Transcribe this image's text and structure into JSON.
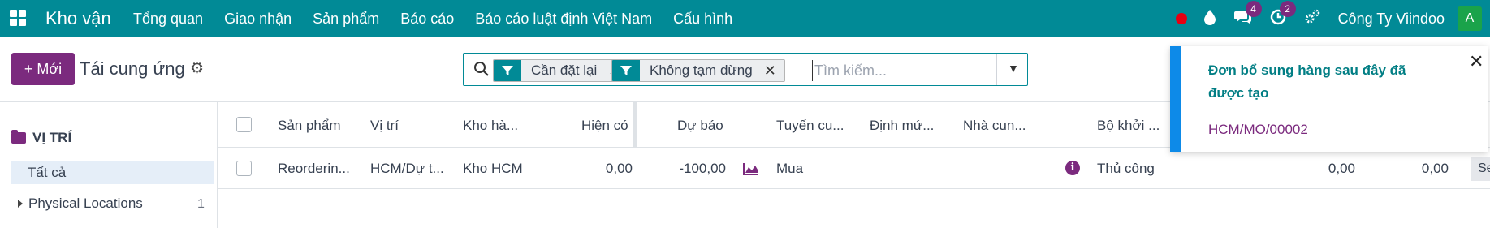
{
  "navbar": {
    "brand": "Kho vận",
    "menu": [
      "Tổng quan",
      "Giao nhận",
      "Sản phẩm",
      "Báo cáo",
      "Báo cáo luật định Việt Nam",
      "Cấu hình"
    ],
    "messages_badge": "4",
    "activities_badge": "2",
    "company": "Công Ty Viindoo",
    "avatar_letter": "A"
  },
  "control": {
    "new_button": "+ Mới",
    "title": "Tái cung ứng",
    "facets": [
      "Cần đặt lại",
      "Không tạm dừng"
    ],
    "facet_remove": "✕",
    "search_placeholder": "Tìm kiếm..."
  },
  "sidebar": {
    "title": "VỊ TRÍ",
    "all_label": "Tất cả",
    "location_label": "Physical Locations",
    "location_count": "1"
  },
  "table": {
    "headers": [
      "Sản phẩm",
      "Vị trí",
      "Kho hà...",
      "Hiện có",
      "Dự báo",
      "Tuyến cu...",
      "Định mứ...",
      "Nhà cun...",
      "Bộ khởi ..."
    ],
    "row": {
      "product": "Reorderin...",
      "location": "HCM/Dự t...",
      "warehouse": "Kho HCM",
      "on_hand": "0,00",
      "forecast": "-100,00",
      "route": "Mua",
      "trigger": "Thủ công",
      "min_qty": "0,00",
      "max_qty": "0,00",
      "action": "Se"
    }
  },
  "notification": {
    "title": "Đơn bổ sung hàng sau đây đã được tạo",
    "link": "HCM/MO/00002",
    "close": "✕"
  },
  "colors": {
    "primary": "#018a96",
    "accent": "#7b2a7e",
    "notif_border": "#0d8ae8"
  }
}
